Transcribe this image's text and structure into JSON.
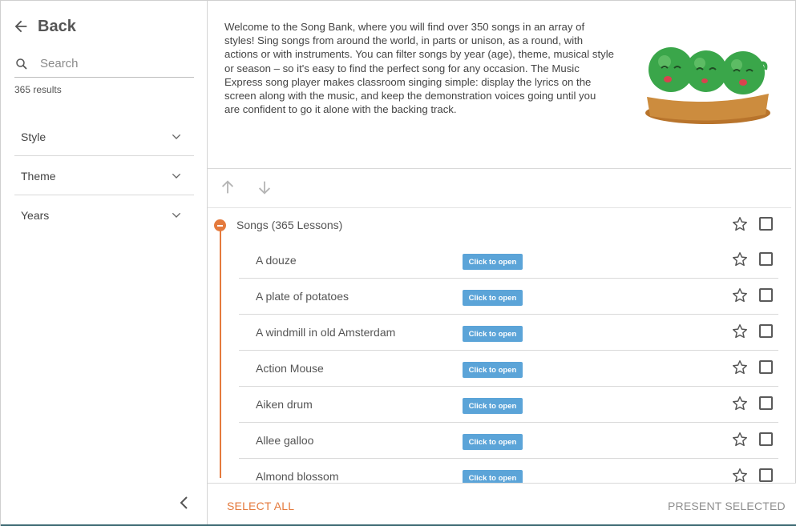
{
  "sidebar": {
    "back_label": "Back",
    "search_placeholder": "Search",
    "results_count": "365 results",
    "filters": [
      {
        "label": "Style"
      },
      {
        "label": "Theme"
      },
      {
        "label": "Years"
      }
    ]
  },
  "main": {
    "intro": "Welcome to the Song Bank, where you will find over 350 songs in an array of styles! Sing songs from around the world, in parts or unison, as a round, with actions or with instruments. You can filter songs by year (age), theme, musical style or season – so it's easy to find the perfect song for any occasion. The Music Express song player makes classroom singing simple: display the lyrics on the screen along with the music, and keep the demonstration voices going until you are confident to go it alone with the backing track.",
    "group_title": "Songs (365 Lessons)",
    "open_button_label": "Click to open",
    "songs": [
      {
        "title": "A douze"
      },
      {
        "title": "A plate of potatoes"
      },
      {
        "title": "A windmill in old Amsterdam"
      },
      {
        "title": "Action Mouse"
      },
      {
        "title": "Aiken drum"
      },
      {
        "title": "Allee galloo"
      },
      {
        "title": "Almond blossom"
      }
    ]
  },
  "footer": {
    "select_all": "SELECT ALL",
    "present_selected": "PRESENT SELECTED"
  },
  "colors": {
    "accent_orange": "#e47a3d",
    "button_blue": "#5ba4d8",
    "pea_green": "#3aa64a",
    "basket_brown": "#c98a3a"
  }
}
